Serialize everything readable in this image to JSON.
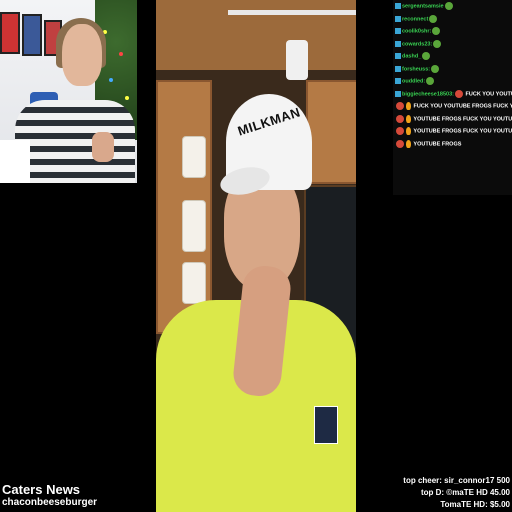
{
  "video": {
    "cap_text": "MILKMAN"
  },
  "chat": {
    "lines": [
      {
        "user": "sergeantsamsie",
        "message": "",
        "emotes": [
          "green"
        ]
      },
      {
        "user": "reconnect",
        "message": "",
        "emotes": [
          "green"
        ]
      },
      {
        "user": "coolik0shr:",
        "message": "",
        "emotes": [
          "green"
        ]
      },
      {
        "user": "cowards23:",
        "message": "",
        "emotes": [
          "green"
        ]
      },
      {
        "user": "dashd_",
        "message": "",
        "emotes": [
          "green"
        ]
      },
      {
        "user": "forsheuss:",
        "message": "",
        "emotes": [
          "green"
        ]
      },
      {
        "user": "ouddled:",
        "message": "",
        "emotes": [
          "green"
        ]
      },
      {
        "user": "biggiecheese18503:",
        "message": "FUCK YOU YOUTUBE FROGS",
        "emotes": [
          "red"
        ]
      },
      {
        "user": "",
        "message": "FUCK YOU YOUTUBE FROGS",
        "emotes": [
          "red",
          "flame"
        ],
        "tail": "FUCK YOU"
      },
      {
        "user": "",
        "message": "YOUTUBE FROGS",
        "emotes": [
          "red",
          "flame"
        ],
        "tail": "FUCK YOU YOUTUBE FROGS"
      },
      {
        "user": "",
        "message": "YOUTUBE FROGS",
        "emotes": [
          "red",
          "flame"
        ],
        "tail": "FUCK YOU YOUTUBE FROGS"
      },
      {
        "user": "",
        "message": "YOUTUBE FROGS",
        "emotes": [
          "red",
          "flame"
        ],
        "tail": ""
      }
    ]
  },
  "overlay": {
    "caters_news": "Caters News",
    "username": "chaconbeeseburger",
    "top_cheer": "top cheer: sir_connor17 500",
    "top_donation": "top D: ©maTE HD 45.00",
    "second_donation": "TomaTE HD: $5.00"
  },
  "colors": {
    "chat_user": "#39d353",
    "shirt": "#dbe84a"
  }
}
